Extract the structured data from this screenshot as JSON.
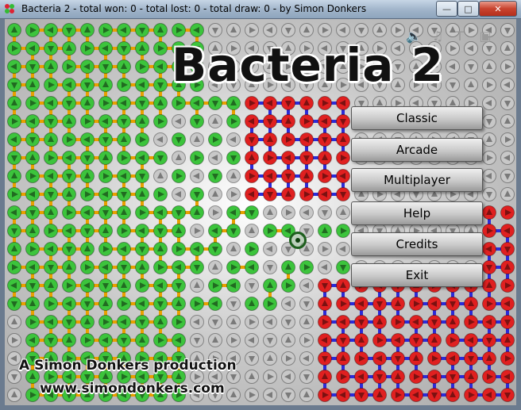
{
  "window": {
    "title": "Bacteria 2 - total won: 0 - total lost: 0 - total draw: 0 - by Simon Donkers",
    "minimize_icon": "minimize-icon",
    "maximize_icon": "maximize-icon",
    "close_icon": "close-icon"
  },
  "game": {
    "logo": "Bacteria 2",
    "menu": [
      "Classic",
      "Arcade",
      "Multiplayer",
      "Help",
      "Credits",
      "Exit"
    ],
    "credit": "A Simon Donkers production",
    "url": "www.simondonkers.com",
    "toolbar_icons": [
      "sound-icon",
      "music-icon",
      "text-icon",
      "screen-icon"
    ],
    "colors": {
      "player_green": "#3cc43c",
      "enemy_red": "#e02020",
      "neutral_gray": "#c8c8c8",
      "green_link": "#e8a000",
      "red_link": "#2b2bd8"
    }
  }
}
